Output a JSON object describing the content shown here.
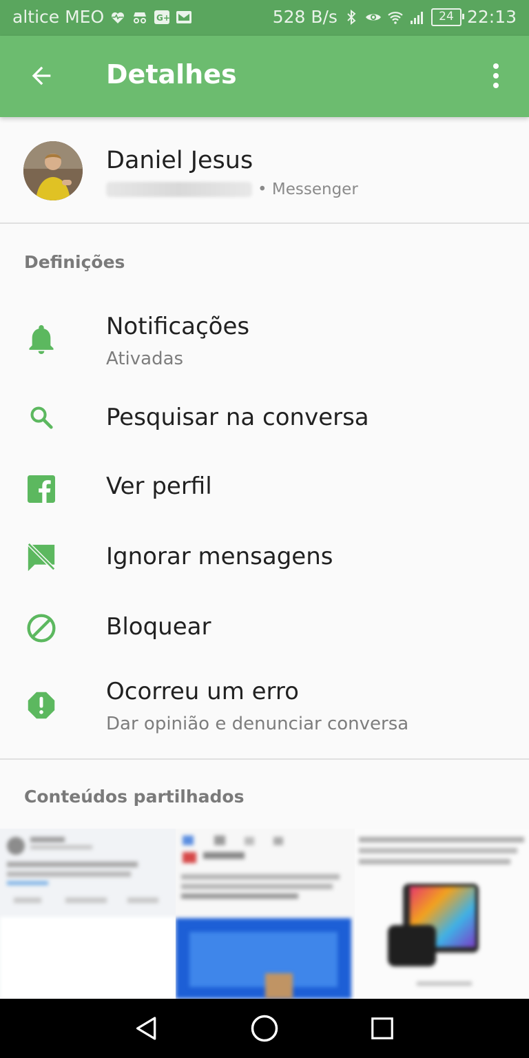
{
  "status_bar": {
    "carrier": "altice MEO",
    "net_speed": "528 B/s",
    "battery": "24",
    "time": "22:13"
  },
  "app_bar": {
    "title": "Detalhes"
  },
  "profile": {
    "name": "Daniel Jesus",
    "platform": "• Messenger"
  },
  "settings": {
    "section_title": "Definições",
    "items": [
      {
        "label": "Notificações",
        "sublabel": "Ativadas",
        "icon": "bell-icon"
      },
      {
        "label": "Pesquisar na conversa",
        "icon": "search-icon"
      },
      {
        "label": "Ver perfil",
        "icon": "facebook-icon"
      },
      {
        "label": "Ignorar mensagens",
        "icon": "ignore-messages-icon"
      },
      {
        "label": "Bloquear",
        "icon": "block-icon"
      },
      {
        "label": "Ocorreu um erro",
        "sublabel": "Dar opinião e denunciar conversa",
        "icon": "alert-icon"
      }
    ]
  },
  "shared": {
    "section_title": "Conteúdos partilhados"
  },
  "colors": {
    "accent": "#5cb85f",
    "app_bar": "#6cbc6f",
    "status_bar": "#5aa65e"
  }
}
